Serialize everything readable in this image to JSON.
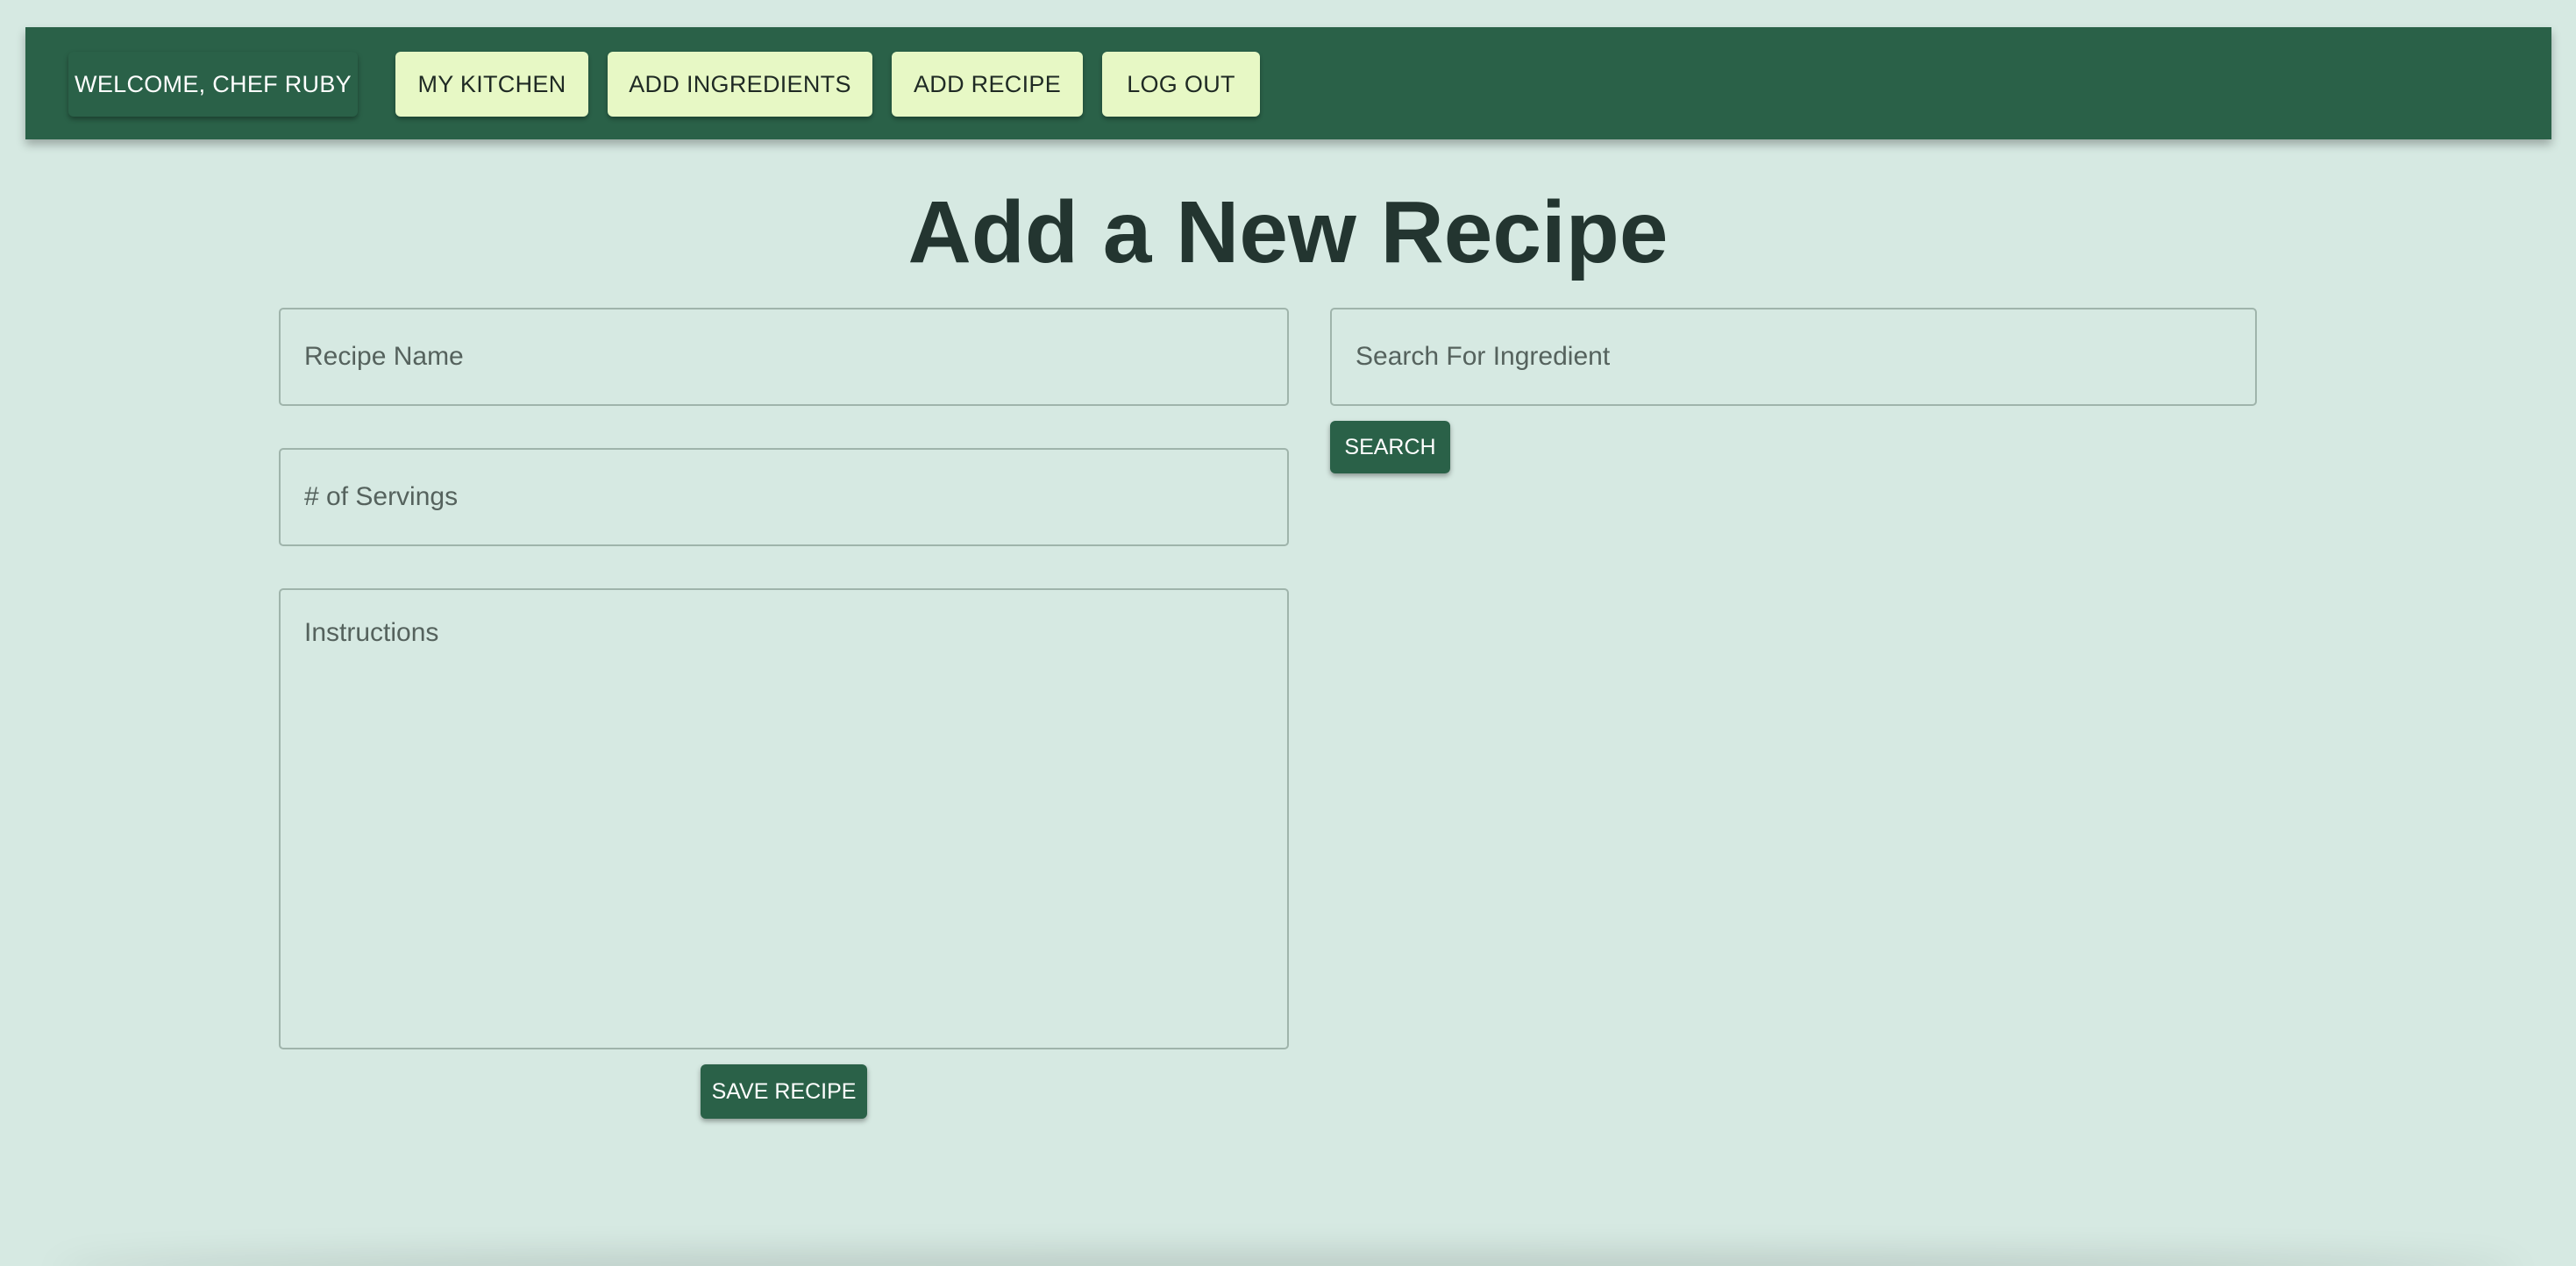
{
  "nav": {
    "welcome_label": "WELCOME, CHEF RUBY",
    "my_kitchen_label": "MY KITCHEN",
    "add_ingredients_label": "ADD INGREDIENTS",
    "add_recipe_label": "ADD RECIPE",
    "log_out_label": "LOG OUT"
  },
  "page": {
    "title": "Add a New Recipe"
  },
  "form": {
    "recipe_name": {
      "value": "",
      "placeholder": "Recipe Name"
    },
    "servings": {
      "value": "",
      "placeholder": "# of Servings"
    },
    "instructions": {
      "value": "",
      "placeholder": "Instructions"
    },
    "save_label": "SAVE RECIPE"
  },
  "ingredient_search": {
    "value": "",
    "placeholder": "Search For Ingredient",
    "search_label": "SEARCH"
  },
  "colors": {
    "primary": "#2a6148",
    "accent_light": "#e7f8c5",
    "background": "#d6e9e2",
    "title_text": "#233530"
  }
}
